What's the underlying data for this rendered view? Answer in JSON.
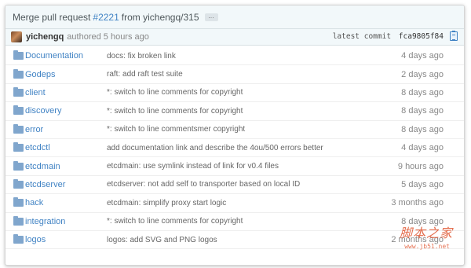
{
  "commit": {
    "title_prefix": "Merge pull request",
    "pr_number": "#2221",
    "title_suffix": "from yichengq/315",
    "ellipsis": "…",
    "author": "yichengq",
    "authored": "authored 5 hours ago",
    "latest_label": "latest commit",
    "sha": "fca9805f84"
  },
  "files": [
    {
      "name": "Documentation",
      "message": "docs: fix broken link",
      "age": "4 days ago",
      "icon": "folder-icon"
    },
    {
      "name": "Godeps",
      "message": "raft: add raft test suite",
      "age": "2 days ago",
      "icon": "folder-icon"
    },
    {
      "name": "client",
      "message": "*: switch to line comments for copyright",
      "age": "8 days ago",
      "icon": "folder-icon"
    },
    {
      "name": "discovery",
      "message": "*: switch to line comments for copyright",
      "age": "8 days ago",
      "icon": "folder-icon"
    },
    {
      "name": "error",
      "message": "*: switch to line commentsmer copyright",
      "age": "8 days ago",
      "icon": "folder-icon"
    },
    {
      "name": "etcdctl",
      "message": "add documentation link and describe the 4ou/500 errors better",
      "age": "4 days ago",
      "icon": "folder-icon"
    },
    {
      "name": "etcdmain",
      "message": "etcdmain: use symlink instead of link for v0.4 files",
      "age": "9 hours ago",
      "icon": "folder-icon"
    },
    {
      "name": "etcdserver",
      "message": "etcdserver: not add self to transporter based on local ID",
      "age": "5 days ago",
      "icon": "folder-icon"
    },
    {
      "name": "hack",
      "message": "etcdmain: simplify proxy start logic",
      "age": "3 months ago",
      "icon": "folder-icon"
    },
    {
      "name": "integration",
      "message": "*: switch to line comments for copyright",
      "age": "8 days ago",
      "icon": "folder-icon"
    },
    {
      "name": "logos",
      "message": "logos: add SVG and PNG logos",
      "age": "2 months ago",
      "icon": "folder-icon"
    }
  ],
  "watermark": {
    "text": "脚本之家",
    "sub": "www.jb51.net"
  }
}
